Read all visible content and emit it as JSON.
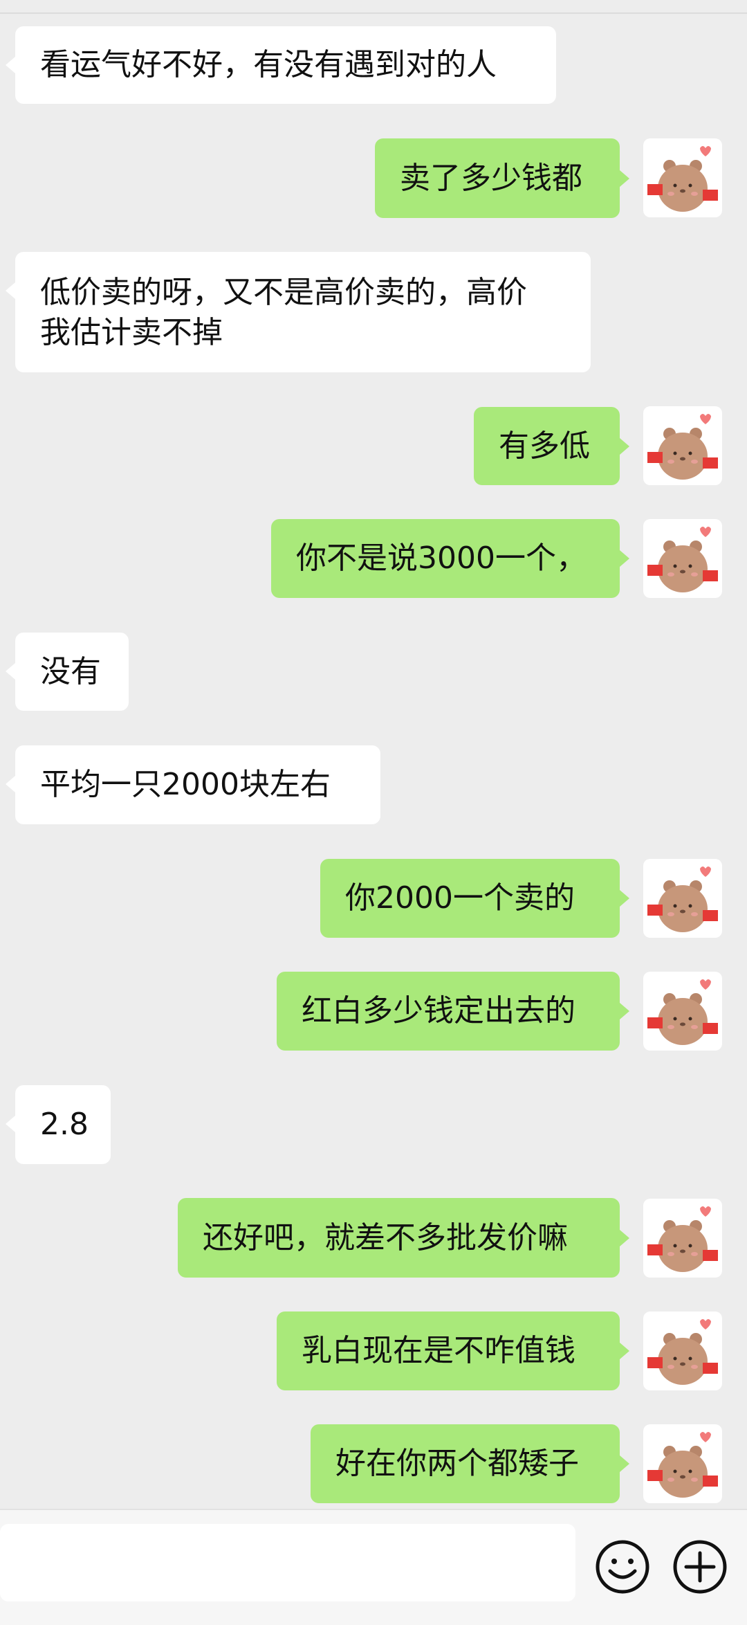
{
  "messages": [
    {
      "side": "left",
      "text": "看运气好不好，有没有遇到对的人"
    },
    {
      "side": "right",
      "text": "卖了多少钱都"
    },
    {
      "side": "left",
      "text": "低价卖的呀，又不是高价卖的，高价\n我估计卖不掉"
    },
    {
      "side": "right",
      "text": "有多低"
    },
    {
      "side": "right",
      "text": "你不是说3000一个，"
    },
    {
      "side": "left",
      "text": "没有"
    },
    {
      "side": "left",
      "text": "平均一只2000块左右"
    },
    {
      "side": "right",
      "text": "你2000一个卖的"
    },
    {
      "side": "right",
      "text": "红白多少钱定出去的"
    },
    {
      "side": "left",
      "text": "2.8"
    },
    {
      "side": "right",
      "text": "还好吧，就差不多批发价嘛"
    },
    {
      "side": "right",
      "text": "乳白现在是不咋值钱"
    },
    {
      "side": "right",
      "text": "好在你两个都矮子"
    }
  ],
  "avatar_icon": "bear-with-flag-icon",
  "input_bar": {
    "emoji_icon": "emoji-smile-icon",
    "plus_icon": "plus-circle-icon"
  },
  "colors": {
    "background": "#ededed",
    "bubble_left": "#ffffff",
    "bubble_right": "#a9e97a"
  }
}
